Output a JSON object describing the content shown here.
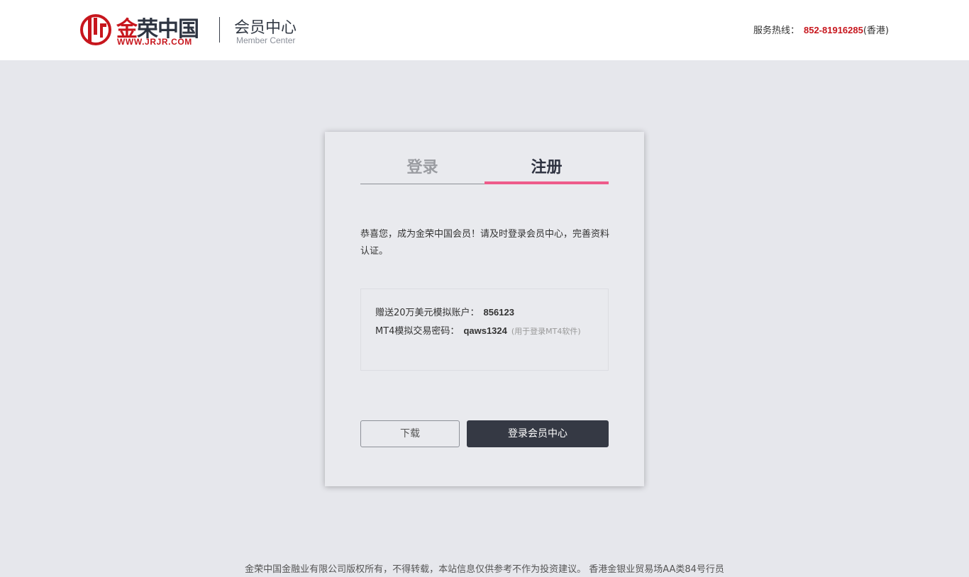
{
  "header": {
    "logo_cn_first": "金",
    "logo_cn_rest": "荣中国",
    "logo_url": "WWW.JRJR.COM",
    "member_center_title": "会员中心",
    "member_center_subtitle": "Member Center",
    "hotline_label": "服务热线：",
    "hotline_number": "852-81916285",
    "hotline_location": "(香港)"
  },
  "tabs": [
    {
      "label": "登录",
      "active": false
    },
    {
      "label": "注册",
      "active": true
    }
  ],
  "message": "恭喜您，成为金荣中国会员！请及时登录会员中心，完善资料认证。",
  "account_info": {
    "demo_label": "赠送20万美元模拟账户：",
    "demo_account": "856123",
    "mt4_label": "MT4模拟交易密码：",
    "mt4_password": "qaws1324",
    "mt4_note": "(用于登录MT4软件)"
  },
  "buttons": {
    "download": "下载",
    "login_member_center": "登录会员中心"
  },
  "footer": "金荣中国金融业有限公司版权所有，不得转载，本站信息仅供参考不作为投资建议。 香港金银业贸易场AA类84号行员",
  "colors": {
    "brand_red": "#c7161d",
    "active_tab_underline": "#ee5b8a",
    "primary_button": "#353944",
    "background": "#e6e7ec"
  }
}
